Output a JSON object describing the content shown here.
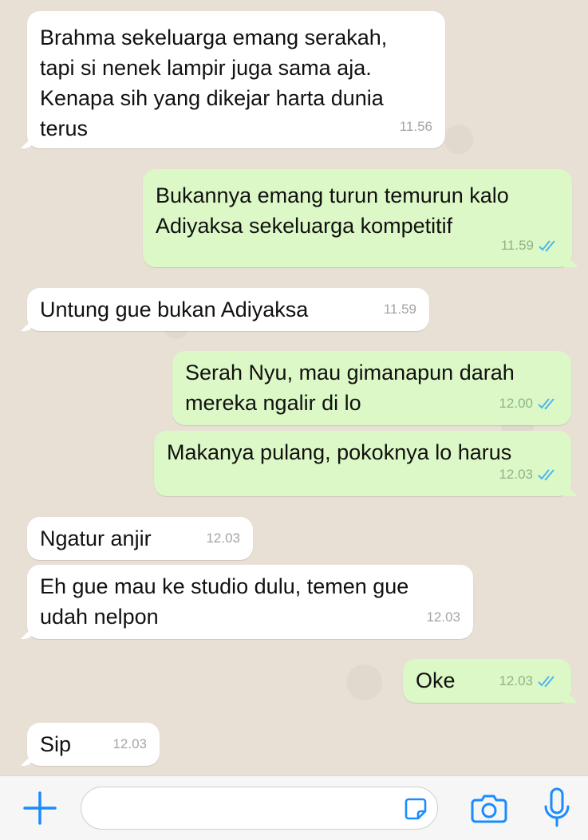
{
  "messages": [
    {
      "direction": "in",
      "text": "Brahma sekeluarga emang serakah,\ntapi si nenek lampir juga sama aja.\nKenapa sih yang dikejar harta dunia\nterus",
      "time": "11.56"
    },
    {
      "direction": "out",
      "text": "Bukannya emang turun temurun kalo\nAdiyaksa sekeluarga kompetitif",
      "time": "11.59",
      "status": "read"
    },
    {
      "direction": "in",
      "text": "Untung gue bukan Adiyaksa",
      "time": "11.59"
    },
    {
      "direction": "out",
      "text": "Serah Nyu, mau gimanapun darah\nmereka ngalir di lo",
      "time": "12.00",
      "status": "read"
    },
    {
      "direction": "out",
      "text": "Makanya pulang, pokoknya lo harus",
      "time": "12.03",
      "status": "read"
    },
    {
      "direction": "in",
      "text": "Ngatur anjir",
      "time": "12.03"
    },
    {
      "direction": "in",
      "text": "Eh gue mau ke studio dulu, temen gue\nudah nelpon",
      "time": "12.03"
    },
    {
      "direction": "out",
      "text": "Oke",
      "time": "12.03",
      "status": "read"
    },
    {
      "direction": "in",
      "text": "Sip",
      "time": "12.03"
    }
  ],
  "input_bar": {
    "text_value": "",
    "icons": [
      "plus-icon",
      "sticker-icon",
      "camera-icon",
      "microphone-icon"
    ],
    "accent_color": "#1a8cff"
  },
  "colors": {
    "incoming_bubble": "#ffffff",
    "outgoing_bubble": "#dcf8c6",
    "read_ticks": "#4fb6ec",
    "chat_background": "#e8e0d5"
  }
}
